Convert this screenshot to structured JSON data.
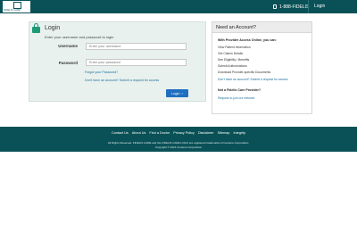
{
  "header": {
    "logo_text": "FIDELIS CARE",
    "phone": "1-888-FIDELIS",
    "login_link": "Login"
  },
  "login": {
    "title": "Login",
    "subtitle": "Enter your username and password to login",
    "username_label": "Username",
    "username_placeholder": "Enter your username",
    "password_label": "Password",
    "password_placeholder": "Enter your password",
    "forgot_link": "Forgot your Password?",
    "no_account_link": "Don't have an account? Submit a request for access",
    "login_button": "Login"
  },
  "account": {
    "title": "Need an Account?",
    "intro": "With Provider Access Online, you can:",
    "items": [
      "View Patient Information",
      "Get Claims Details",
      "See Eligibility / Benefits",
      "Submit Authorizations",
      "Download Provider-specific Documents"
    ],
    "request_link": "Don't have an account? Submit a request for access",
    "not_provider": "Not a Fidelis Care Provider?",
    "join_link": "Request to join our network"
  },
  "footer": {
    "links": [
      "Contact Us",
      "About Us",
      "Find a Doctor",
      "Privacy Policy",
      "Disclaimer",
      "Sitemap",
      "Integrity"
    ],
    "rights": "All Rights Reserved. FIDELIS CARE and the FIDELIS CARE LOGO are registered trademarks of Centene Corporation.",
    "copyright": "Copyright © 2021 Centene Corporation"
  }
}
